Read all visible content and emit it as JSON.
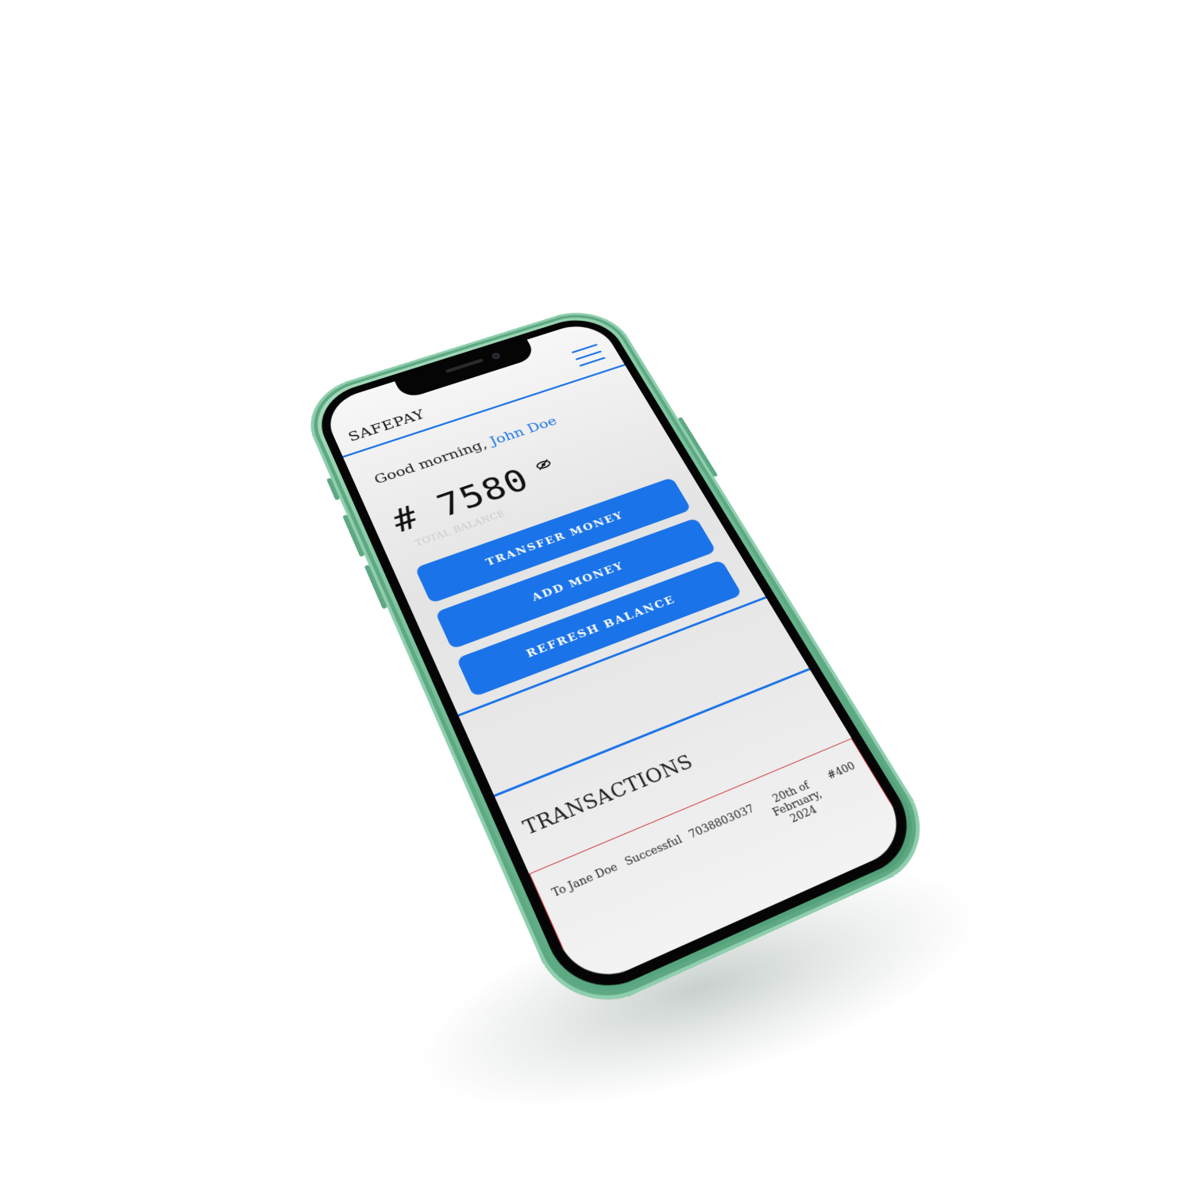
{
  "app": {
    "brand": "SAFEPAY",
    "menu_icon": "hamburger-menu-icon"
  },
  "greeting": {
    "prefix": "Good morning,",
    "name": "John Doe"
  },
  "balance": {
    "amount": "# 7580",
    "label": "TOTAL BALANCE",
    "visibility_icon": "eye-slash-icon"
  },
  "actions": {
    "transfer": "TRANSFER MONEY",
    "add": "ADD MONEY",
    "refresh": "REFRESH BALANCE"
  },
  "transactions": {
    "title": "TRANSACTIONS",
    "rows": [
      {
        "recipient": "To Jane Doe",
        "status": "Successful",
        "account": "7038803037",
        "date": "20th of February, 2024",
        "amount": "#400"
      }
    ]
  },
  "colors": {
    "accent": "#1a73e8",
    "phone_frame": "#79c39c",
    "table_border": "#d0434b",
    "background": "#ffffff"
  }
}
